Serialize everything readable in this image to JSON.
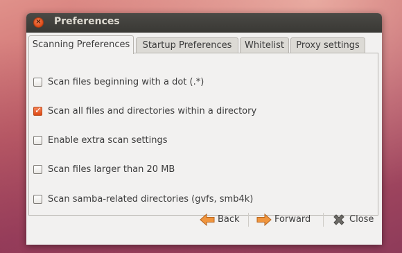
{
  "window": {
    "title": "Preferences"
  },
  "tabs": [
    {
      "label": "Scanning Preferences",
      "active": true
    },
    {
      "label": "Startup Preferences",
      "active": false
    },
    {
      "label": "Whitelist",
      "active": false
    },
    {
      "label": "Proxy settings",
      "active": false
    }
  ],
  "options": [
    {
      "label": "Scan files beginning with a dot (.*)",
      "checked": false
    },
    {
      "label": "Scan all files and directories within a directory",
      "checked": true
    },
    {
      "label": "Enable extra scan settings",
      "checked": false
    },
    {
      "label": "Scan files larger than 20 MB",
      "checked": false
    },
    {
      "label": "Scan samba-related directories (gvfs, smb4k)",
      "checked": false
    }
  ],
  "buttons": {
    "back": {
      "label": "Back",
      "icon": "arrow-left-icon"
    },
    "forward": {
      "label": "Forward",
      "icon": "arrow-right-icon"
    },
    "close": {
      "label": "Close",
      "icon": "close-x-icon"
    }
  },
  "colors": {
    "accent": "#dd4814",
    "titlebar": "#3c3b37",
    "arrow": "#f0953d"
  }
}
